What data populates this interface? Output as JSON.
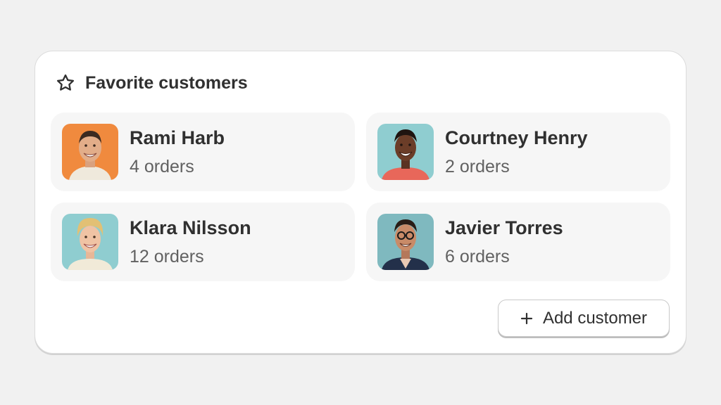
{
  "card": {
    "title": "Favorite customers",
    "title_icon": "star-icon"
  },
  "customers": [
    {
      "name": "Rami Harb",
      "orders": "4 orders",
      "avatar_bg": "#f08a3e"
    },
    {
      "name": "Courtney Henry",
      "orders": "2 orders",
      "avatar_bg": "#8fcdd0"
    },
    {
      "name": "Klara Nilsson",
      "orders": "12 orders",
      "avatar_bg": "#8fcdd0"
    },
    {
      "name": "Javier Torres",
      "orders": "6 orders",
      "avatar_bg": "#7fb9bf"
    }
  ],
  "actions": {
    "add_label": "Add customer",
    "add_icon": "plus-icon"
  },
  "colors": {
    "background": "#f1f1f1",
    "card": "#ffffff",
    "tile": "#f6f6f6",
    "text_primary": "#303030",
    "text_secondary": "#616161"
  }
}
